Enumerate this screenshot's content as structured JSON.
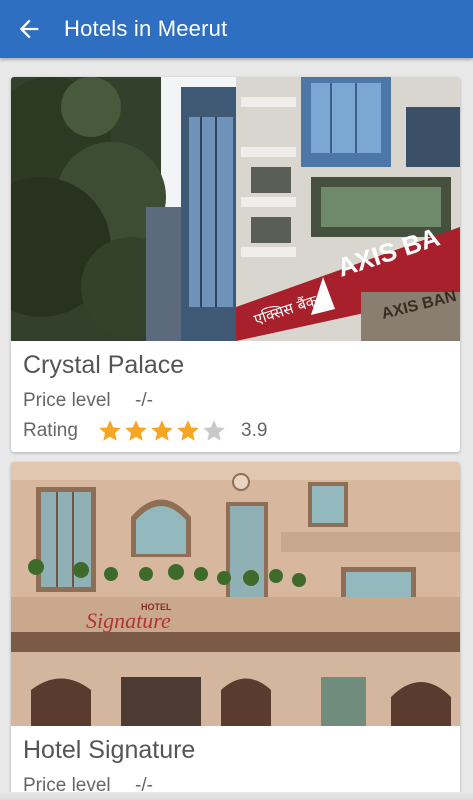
{
  "appbar": {
    "title": "Hotels in Meerut",
    "back_icon": "arrow-left-icon",
    "color": "#2f6fc1"
  },
  "hotels": [
    {
      "name": "Crystal Palace",
      "price_label": "Price level",
      "price_value": "-/-",
      "rating_label": "Rating",
      "rating": 3.9,
      "rating_text": "3.9",
      "stars_filled": 4,
      "stars_total": 5,
      "photo_signs": [
        "AXIS BA",
        "एक्सिस बैंक",
        "AXIS BAN"
      ]
    },
    {
      "name": "Hotel Signature",
      "price_label": "Price level",
      "price_value": "-/-",
      "photo_signs": [
        "HOTEL",
        "Signature"
      ]
    }
  ],
  "colors": {
    "star_filled": "#f6a623",
    "star_empty": "#c9c9c9",
    "axis_red": "#a8202c"
  }
}
